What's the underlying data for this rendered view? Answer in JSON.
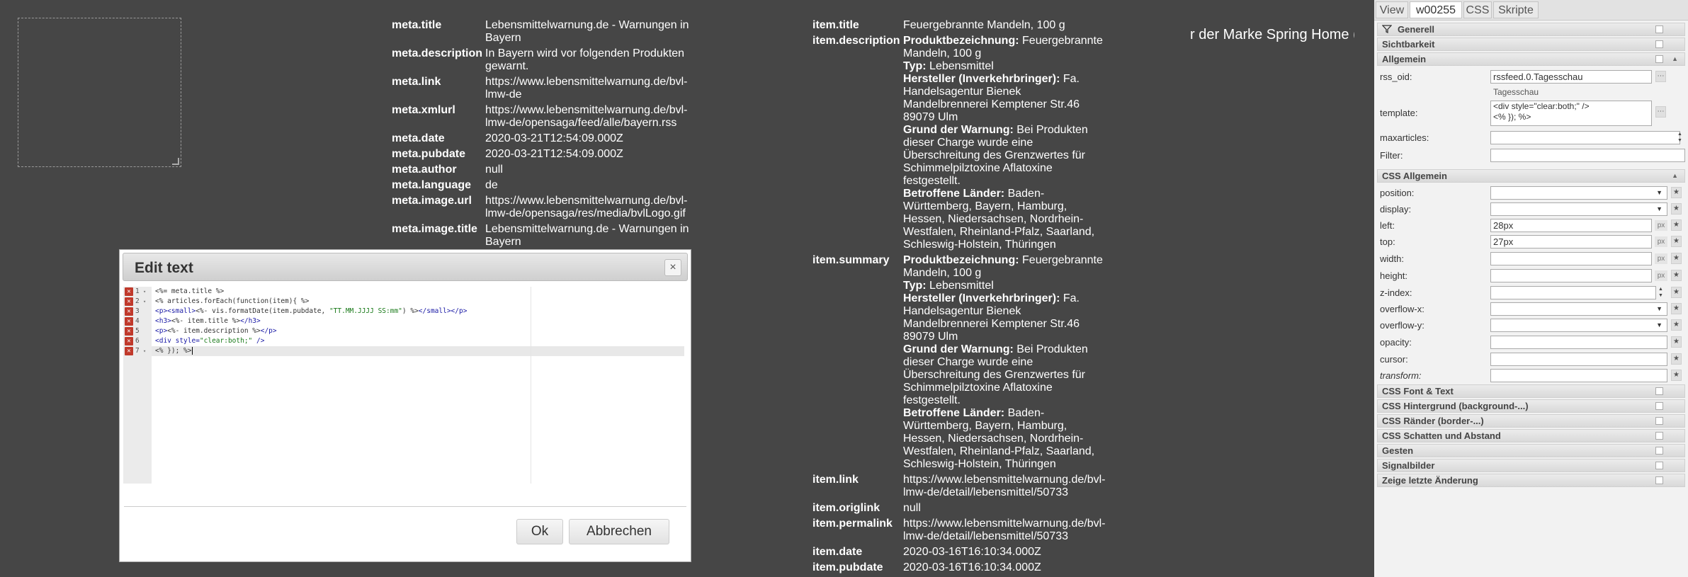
{
  "marquee_text": "r der Marke Spring Home (",
  "meta": [
    {
      "key": "meta.title",
      "value": "Lebensmittelwarnung.de - Warnungen in Bayern"
    },
    {
      "key": "meta.description",
      "value": "In Bayern wird vor folgenden Produkten gewarnt."
    },
    {
      "key": "meta.link",
      "value": "https://www.lebensmittelwarnung.de/bvl-lmw-de"
    },
    {
      "key": "meta.xmlurl",
      "value": "https://www.lebensmittelwarnung.de/bvl-lmw-de/opensaga/feed/alle/bayern.rss"
    },
    {
      "key": "meta.date",
      "value": "2020-03-21T12:54:09.000Z"
    },
    {
      "key": "meta.pubdate",
      "value": "2020-03-21T12:54:09.000Z"
    },
    {
      "key": "meta.author",
      "value": "null"
    },
    {
      "key": "meta.language",
      "value": "de"
    },
    {
      "key": "meta.image.url",
      "value": "https://www.lebensmittelwarnung.de/bvl-lmw-de/opensaga/res/media/bvlLogo.gif"
    },
    {
      "key": "meta.image.title",
      "value": "Lebensmittelwarnung.de - Warnungen in Bayern"
    }
  ],
  "item": {
    "title_key": "item.title",
    "title_value": "Feuergebrannte Mandeln, 100 g",
    "description_key": "item.description",
    "summary_key": "item.summary",
    "detail": {
      "l1_label": "Produktbezeichnung:",
      "l1_value": "Feuergebrannte Mandeln, 100 g",
      "l2_label": "Typ:",
      "l2_value": "Lebensmittel",
      "l3_label": "Hersteller (Inverkehrbringer):",
      "l3_value": "Fa. Handelsagentur Bienek Mandelbrennerei Kemptener Str.46 89079 Ulm",
      "l4_label": "Grund der Warnung:",
      "l4_value": "Bei Produkten dieser Charge wurde eine Überschreitung des Grenzwertes für Schimmelpilztoxine Aflatoxine festgestellt.",
      "l5_label": "Betroffene Länder:",
      "l5_value": "Baden-Württemberg, Bayern, Hamburg, Hessen, Niedersachsen, Nordrhein-Westfalen, Rheinland-Pfalz, Saarland, Schleswig-Holstein, Thüringen"
    },
    "rest": [
      {
        "key": "item.link",
        "value": "https://www.lebensmittelwarnung.de/bvl-lmw-de/detail/lebensmittel/50733"
      },
      {
        "key": "item.origlink",
        "value": "null"
      },
      {
        "key": "item.permalink",
        "value": "https://www.lebensmittelwarnung.de/bvl-lmw-de/detail/lebensmittel/50733"
      },
      {
        "key": "item.date",
        "value": "2020-03-16T16:10:34.000Z"
      },
      {
        "key": "item.pubdate",
        "value": "2020-03-16T16:10:34.000Z"
      }
    ]
  },
  "dialog": {
    "title": "Edit text",
    "close_glyph": "×",
    "ok_label": "Ok",
    "cancel_label": "Abbrechen",
    "code": {
      "l1": "<%= meta.title %>",
      "l2": "<% articles.forEach(function(item){ %>",
      "l3_open": "<p><small>",
      "l3_mid": "<%- vis.formatDate(item.pubdate, ",
      "l3_str": "\"TT.MM.JJJJ SS:mm\"",
      "l3_end": ") %>",
      "l3_close": "</small></p>",
      "l4_open": "<h3>",
      "l4_mid": "<%- item.title %>",
      "l4_close": "</h3>",
      "l5_open": "<p>",
      "l5_mid": "<%- item.description %>",
      "l5_close": "</p>",
      "l6_open": "<div style=",
      "l6_str": "\"clear:both;\"",
      "l6_close": " />",
      "l7": "<% }); %>"
    },
    "line_numbers": [
      "1",
      "2",
      "3",
      "4",
      "5",
      "6",
      "7"
    ],
    "error_glyph": "✕"
  },
  "panel": {
    "tabs": [
      "View",
      "w00255",
      "CSS",
      "Skripte"
    ],
    "sections": {
      "generell": "Generell",
      "sichtbarkeit": "Sichtbarkeit",
      "allgemein": "Allgemein",
      "css_allgemein": "CSS Allgemein",
      "font": "CSS Font & Text",
      "hintergrund": "CSS Hintergrund (background-...)",
      "raender": "CSS Ränder (border-...)",
      "schatten": "CSS Schatten und Abstand",
      "gesten": "Gesten",
      "signalbilder": "Signalbilder",
      "letzte": "Zeige letzte Änderung"
    },
    "props": {
      "rss_oid_label": "rss_oid:",
      "rss_oid_value": "rssfeed.0.Tagesschau",
      "rss_oid_hint": "Tagesschau",
      "template_label": "template:",
      "template_value_1": "<div style=\"clear:both;\" />",
      "template_value_2": "<% }); %>",
      "maxarticles_label": "maxarticles:",
      "filter_label": "Filter:",
      "position_label": "position:",
      "display_label": "display:",
      "left_label": "left:",
      "left_value": "28px",
      "top_label": "top:",
      "top_value": "27px",
      "width_label": "width:",
      "height_label": "height:",
      "zindex_label": "z-index:",
      "overflowx_label": "overflow-x:",
      "overflowy_label": "overflow-y:",
      "opacity_label": "opacity:",
      "cursor_label": "cursor:",
      "transform_label": "transform:",
      "unit": "px",
      "star": "★",
      "dots": "⋯",
      "select_arrow": "▼"
    }
  }
}
